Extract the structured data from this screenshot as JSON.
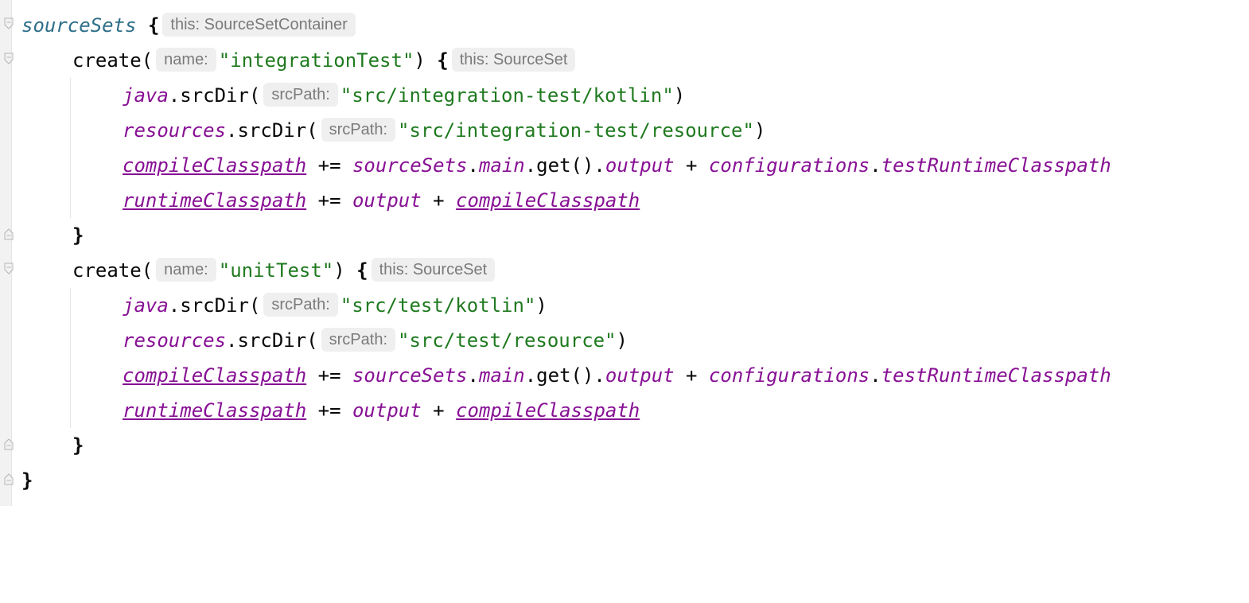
{
  "code": {
    "lines": [
      {
        "id": "l1",
        "parts": [
          {
            "t": "sourceSets",
            "c": "obj"
          },
          {
            "t": " "
          },
          {
            "t": "{",
            "c": "brace"
          },
          {
            "hint": "this: SourceSetContainer"
          }
        ]
      },
      {
        "id": "l2",
        "parts": [
          {
            "t": "create(",
            "c": "fn"
          },
          {
            "hint": "name:"
          },
          {
            "t": "\"integrationTest\"",
            "c": "str"
          },
          {
            "t": ") "
          },
          {
            "t": "{",
            "c": "brace"
          },
          {
            "hint": "this: SourceSet"
          }
        ]
      },
      {
        "id": "l3",
        "parts": [
          {
            "t": "java",
            "c": "ext"
          },
          {
            "t": ".srcDir(",
            "c": "fn"
          },
          {
            "hint": "srcPath:"
          },
          {
            "t": "\"src/integration-test/kotlin\"",
            "c": "str"
          },
          {
            "t": ")"
          }
        ]
      },
      {
        "id": "l4",
        "parts": [
          {
            "t": "resources",
            "c": "ext"
          },
          {
            "t": ".srcDir(",
            "c": "fn"
          },
          {
            "hint": "srcPath:"
          },
          {
            "t": "\"src/integration-test/resource\"",
            "c": "str"
          },
          {
            "t": ")"
          }
        ]
      },
      {
        "id": "l5",
        "parts": [
          {
            "t": "compileClasspath",
            "c": "extu"
          },
          {
            "t": " += "
          },
          {
            "t": "sourceSets",
            "c": "ext"
          },
          {
            "t": "."
          },
          {
            "t": "main",
            "c": "ext"
          },
          {
            "t": ".get()."
          },
          {
            "t": "output",
            "c": "ext"
          },
          {
            "t": " + "
          },
          {
            "t": "configurations",
            "c": "ext"
          },
          {
            "t": "."
          },
          {
            "t": "testRuntimeClasspath",
            "c": "ext"
          }
        ]
      },
      {
        "id": "l6",
        "parts": [
          {
            "t": "runtimeClasspath",
            "c": "extu"
          },
          {
            "t": " += "
          },
          {
            "t": "output",
            "c": "ext"
          },
          {
            "t": " + "
          },
          {
            "t": "compileClasspath",
            "c": "extu"
          }
        ]
      },
      {
        "id": "l7",
        "parts": [
          {
            "t": "}",
            "c": "brace"
          }
        ]
      },
      {
        "id": "l8",
        "parts": [
          {
            "t": "create(",
            "c": "fn"
          },
          {
            "hint": "name:"
          },
          {
            "t": "\"unitTest\"",
            "c": "str"
          },
          {
            "t": ") "
          },
          {
            "t": "{",
            "c": "brace"
          },
          {
            "hint": "this: SourceSet"
          }
        ]
      },
      {
        "id": "l9",
        "parts": [
          {
            "t": "java",
            "c": "ext"
          },
          {
            "t": ".srcDir(",
            "c": "fn"
          },
          {
            "hint": "srcPath:"
          },
          {
            "t": "\"src/test/kotlin\"",
            "c": "str"
          },
          {
            "t": ")"
          }
        ]
      },
      {
        "id": "l10",
        "parts": [
          {
            "t": "resources",
            "c": "ext"
          },
          {
            "t": ".srcDir(",
            "c": "fn"
          },
          {
            "hint": "srcPath:"
          },
          {
            "t": "\"src/test/resource\"",
            "c": "str"
          },
          {
            "t": ")"
          }
        ]
      },
      {
        "id": "l11",
        "parts": [
          {
            "t": "compileClasspath",
            "c": "extu"
          },
          {
            "t": " += "
          },
          {
            "t": "sourceSets",
            "c": "ext"
          },
          {
            "t": "."
          },
          {
            "t": "main",
            "c": "ext"
          },
          {
            "t": ".get()."
          },
          {
            "t": "output",
            "c": "ext"
          },
          {
            "t": " + "
          },
          {
            "t": "configurations",
            "c": "ext"
          },
          {
            "t": "."
          },
          {
            "t": "testRuntimeClasspath",
            "c": "ext"
          }
        ]
      },
      {
        "id": "l12",
        "parts": [
          {
            "t": "runtimeClasspath",
            "c": "extu"
          },
          {
            "t": " += "
          },
          {
            "t": "output",
            "c": "ext"
          },
          {
            "t": " + "
          },
          {
            "t": "compileClasspath",
            "c": "extu"
          }
        ]
      },
      {
        "id": "l13",
        "parts": [
          {
            "t": "}",
            "c": "brace"
          }
        ]
      },
      {
        "id": "l14",
        "parts": [
          {
            "t": "}",
            "c": "brace"
          }
        ]
      }
    ]
  },
  "colors": {
    "string": "#1f7a1f",
    "extension": "#871094",
    "object": "#2f6f8a",
    "hint_bg": "#efefef",
    "hint_text": "#7a7a7a"
  },
  "icons": {
    "fold_open": "fold-open-icon",
    "fold_close": "fold-close-icon"
  }
}
